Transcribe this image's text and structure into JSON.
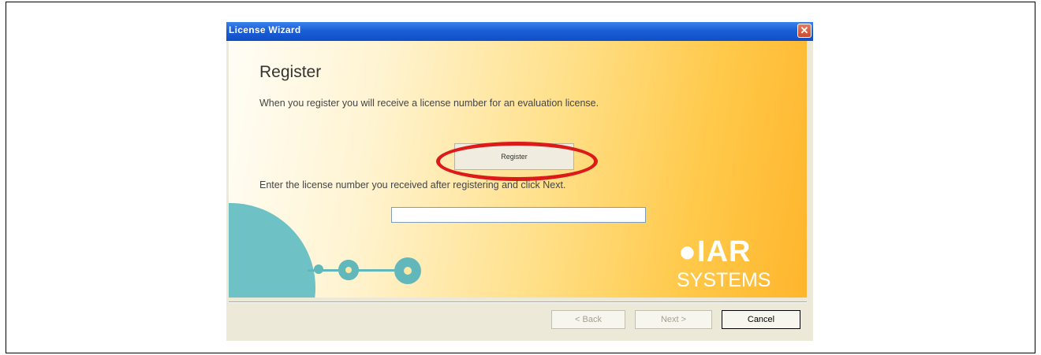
{
  "window": {
    "title": "License Wizard",
    "close_glyph": "✕"
  },
  "content": {
    "heading": "Register",
    "description": "When you register you will receive a license number for an evaluation license.",
    "register_button": "Register",
    "enter_label": "Enter the license number you received after registering and click Next.",
    "license_input_value": ""
  },
  "logo": {
    "line1": "IAR",
    "line2": "SYSTEMS"
  },
  "footer": {
    "back_label": "< Back",
    "next_label": "Next >",
    "cancel_label": "Cancel"
  },
  "colors": {
    "titlebar": "#0f4ec7",
    "highlight": "#dc1a1a",
    "decoration": "#62b7bb"
  }
}
